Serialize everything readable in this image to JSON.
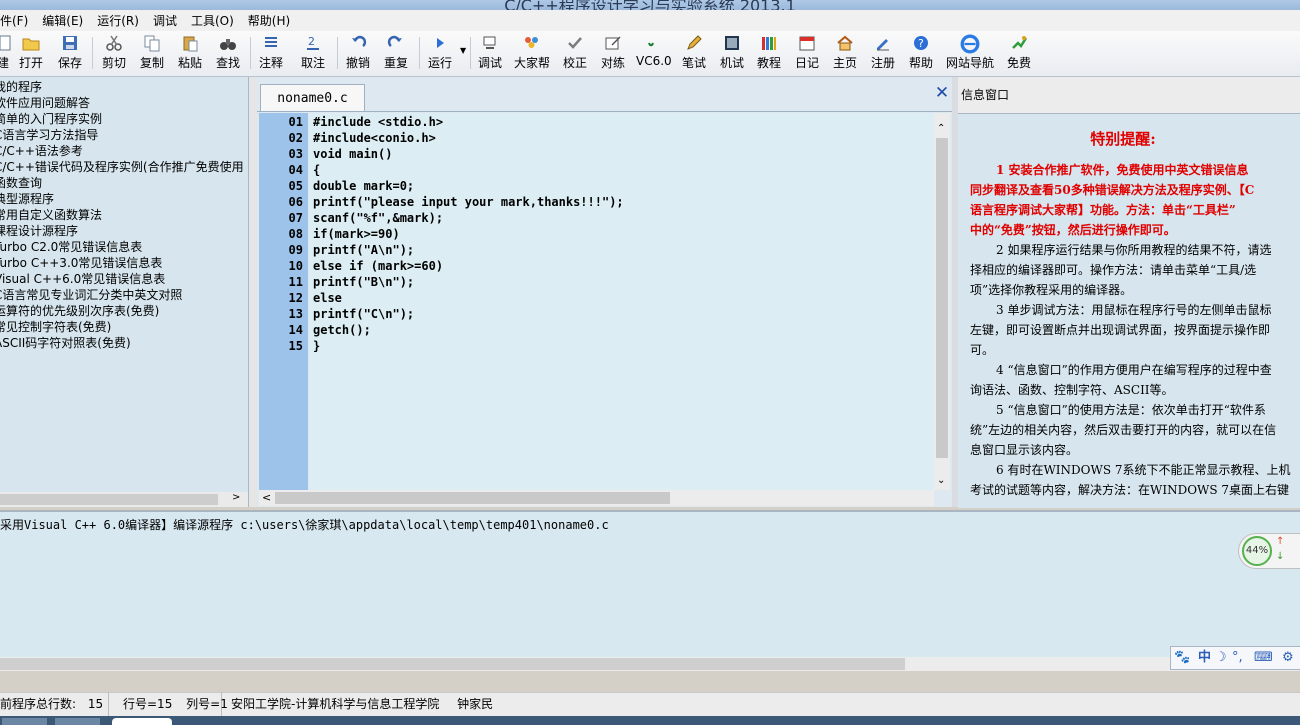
{
  "window": {
    "title": "C/C++程序设计学习与实验系统 2013.1"
  },
  "menu": [
    "件(F)",
    "编辑(E)",
    "运行(R)",
    "调试",
    "工具(O)",
    "帮助(H)"
  ],
  "toolbar": [
    {
      "label": "建",
      "icon": "new-file-icon"
    },
    {
      "label": "打开",
      "icon": "open-folder-icon"
    },
    {
      "label": "保存",
      "icon": "save-disk-icon"
    },
    {
      "label": "剪切",
      "icon": "scissors-icon"
    },
    {
      "label": "复制",
      "icon": "copy-icon"
    },
    {
      "label": "粘贴",
      "icon": "paste-icon"
    },
    {
      "label": "查找",
      "icon": "binoculars-icon"
    },
    {
      "label": "注释",
      "icon": "comment-icon"
    },
    {
      "label": "取注",
      "icon": "uncomment-icon"
    },
    {
      "label": "撤销",
      "icon": "undo-icon"
    },
    {
      "label": "重复",
      "icon": "redo-icon"
    },
    {
      "label": "运行",
      "icon": "run-triangle-icon"
    },
    {
      "label": "调试",
      "icon": "debug-icon"
    },
    {
      "label": "大家帮",
      "icon": "people-icon"
    },
    {
      "label": "校正",
      "icon": "checkmark-icon"
    },
    {
      "label": "对练",
      "icon": "practice-icon"
    },
    {
      "label": "VC6.0",
      "icon": "vc6-icon"
    },
    {
      "label": "笔试",
      "icon": "pen-icon"
    },
    {
      "label": "机试",
      "icon": "computer-test-icon"
    },
    {
      "label": "教程",
      "icon": "books-icon"
    },
    {
      "label": "日记",
      "icon": "calendar-icon"
    },
    {
      "label": "主页",
      "icon": "home-icon"
    },
    {
      "label": "注册",
      "icon": "register-icon"
    },
    {
      "label": "帮助",
      "icon": "help-icon"
    },
    {
      "label": "网站导航",
      "icon": "ie-browser-icon"
    },
    {
      "label": "免费",
      "icon": "free-icon"
    }
  ],
  "tree": [
    "我的程序",
    "软件应用问题解答",
    "简单的入门程序实例",
    "C语言学习方法指导",
    "C/C++语法参考",
    "C/C++错误代码及程序实例(合作推广免费使用",
    "函数查询",
    "典型源程序",
    "常用自定义函数算法",
    "课程设计源程序",
    "Turbo C2.0常见错误信息表",
    "Turbo C++3.0常见错误信息表",
    "Visual C++6.0常见错误信息表",
    "C语言常见专业词汇分类中英文对照",
    "运算符的优先级别次序表(免费)",
    "常见控制字符表(免费)",
    "ASCII码字符对照表(免费)"
  ],
  "editor": {
    "tab": "noname0.c",
    "line_numbers": [
      "01",
      "02",
      "03",
      "04",
      "05",
      "06",
      "07",
      "08",
      "09",
      "10",
      "11",
      "12",
      "13",
      "14",
      "15"
    ],
    "lines": [
      "#include <stdio.h>",
      "#include<conio.h>",
      "void main()",
      "{",
      "double mark=0;",
      "printf(\"please input your mark,thanks!!!\");",
      "scanf(\"%f\",&mark);",
      "if(mark>=90)",
      "printf(\"A\\n\");",
      "else if (mark>=60)",
      "printf(\"B\\n\");",
      "else",
      "printf(\"C\\n\");",
      "getch();",
      "}"
    ]
  },
  "info": {
    "title": "信息窗口",
    "heading": "特别提醒:",
    "lines": [
      {
        "text": "1 安装合作推广软件，免费使用中英文错误信息",
        "red": true,
        "indent": true
      },
      {
        "text": "同步翻译及查看50多种错误解决方法及程序实例、【C",
        "red": true
      },
      {
        "text": "语言程序调试大家帮】功能。方法：单击“工具栏”",
        "red": true
      },
      {
        "text": "中的“免费”按钮，然后进行操作即可。",
        "red": true
      },
      {
        "text": "2 如果程序运行结果与你所用教程的结果不符，请选",
        "indent": true
      },
      {
        "text": "择相应的编译器即可。操作方法：请单击菜单“工具/选"
      },
      {
        "text": "项”选择你教程采用的编译器。"
      },
      {
        "text": "3 单步调试方法：用鼠标在程序行号的左侧单击鼠标",
        "indent": true
      },
      {
        "text": "左键，即可设置断点并出现调试界面，按界面提示操作即"
      },
      {
        "text": "可。"
      },
      {
        "text": "4 “信息窗口”的作用方便用户在编写程序的过程中查",
        "indent": true
      },
      {
        "text": "询语法、函数、控制字符、ASCII等。"
      },
      {
        "text": "5 “信息窗口”的使用方法是：依次单击打开“软件系",
        "indent": true
      },
      {
        "text": "统”左边的相关内容，然后双击要打开的内容，就可以在信"
      },
      {
        "text": "息窗口显示该内容。"
      },
      {
        "text": "6 有时在WINDOWS 7系统下不能正常显示教程、上机",
        "indent": true
      },
      {
        "text": "考试的试题等内容，解决方法：在WINDOWS 7桌面上右键"
      }
    ]
  },
  "output": {
    "text": "采用Visual C++ 6.0编译器】编译源程序 c:\\users\\徐家琪\\appdata\\local\\temp\\temp401\\noname0.c"
  },
  "status": {
    "total_label": "前程序总行数:",
    "total_value": "15",
    "row": "行号=15",
    "col": "列号=1",
    "org": "安阳工学院-计算机科学与信息工程学院",
    "author": "钟家民"
  },
  "widget": {
    "percent": "44%"
  },
  "ime": {
    "mode": "中"
  }
}
